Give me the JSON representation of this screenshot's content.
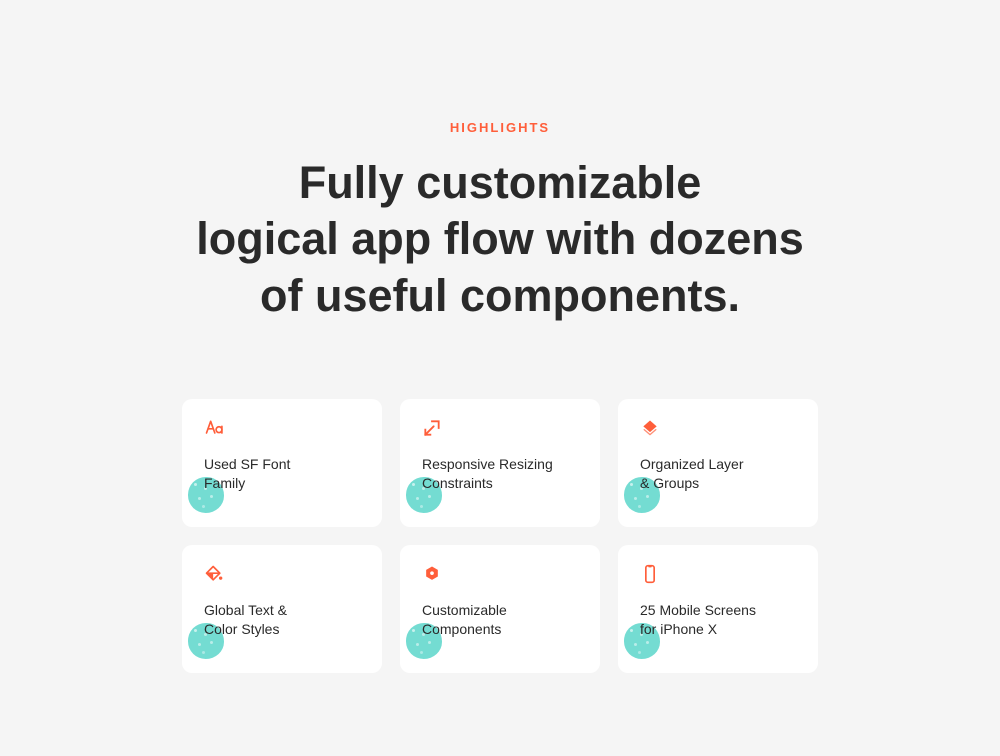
{
  "eyebrow": "HIGHLIGHTS",
  "headline_line1": "Fully customizable",
  "headline_line2": "logical app flow with dozens",
  "headline_line3": "of useful components.",
  "colors": {
    "accent": "#FF5E3A",
    "blob": "#5CD6CB",
    "text": "#2a2a2a",
    "bg": "#f5f5f5",
    "card_bg": "#ffffff"
  },
  "features": [
    {
      "icon": "typography-icon",
      "title_l1": "Used SF Font",
      "title_l2": "Family"
    },
    {
      "icon": "resize-icon",
      "title_l1": "Responsive Resizing",
      "title_l2": "Constraints"
    },
    {
      "icon": "layer-diamond-icon",
      "title_l1": "Organized Layer",
      "title_l2": "& Groups"
    },
    {
      "icon": "paint-bucket-icon",
      "title_l1": "Global Text &",
      "title_l2": "Color Styles"
    },
    {
      "icon": "component-hex-icon",
      "title_l1": "Customizable",
      "title_l2": "Components"
    },
    {
      "icon": "phone-icon",
      "title_l1": "25 Mobile Screens",
      "title_l2": "for iPhone X"
    }
  ]
}
